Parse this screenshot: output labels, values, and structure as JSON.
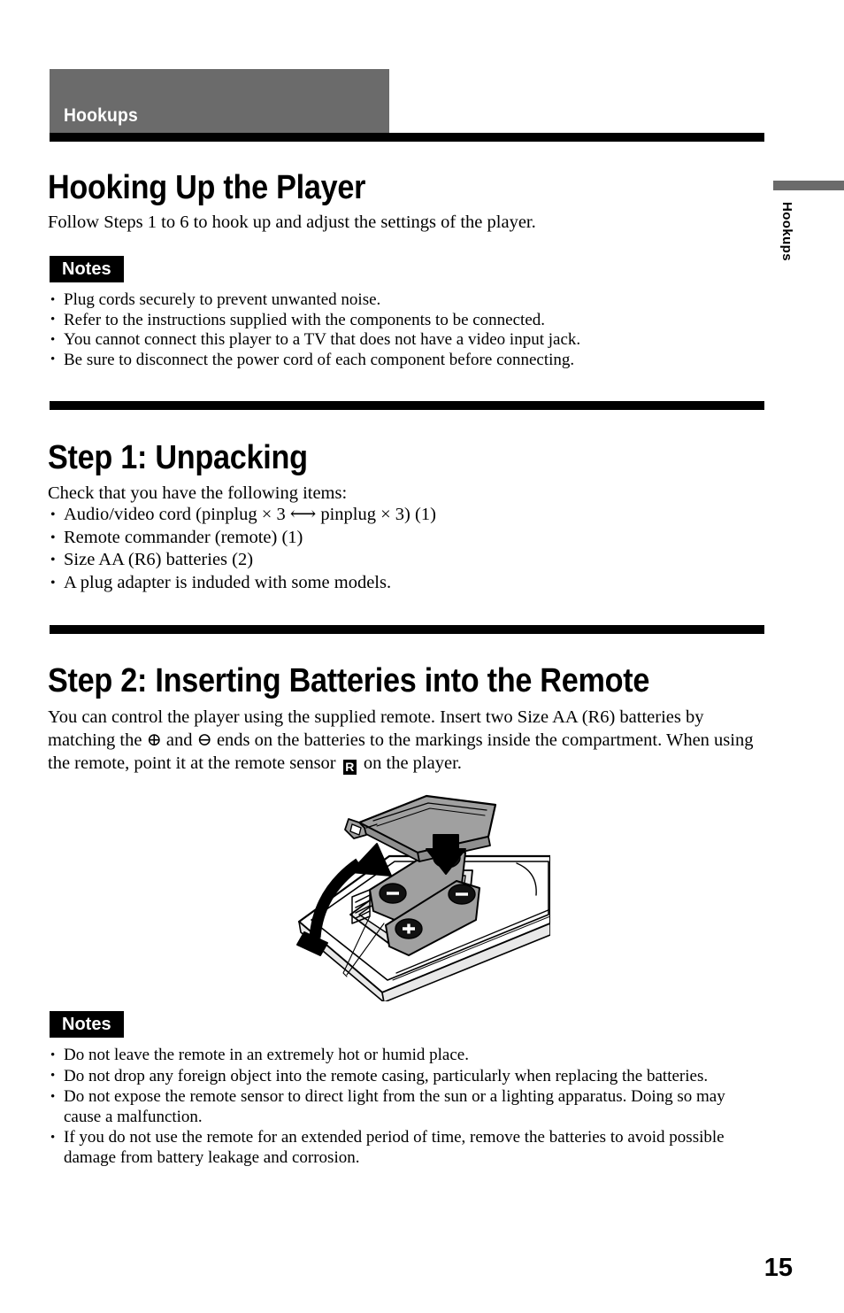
{
  "page": {
    "number": "15",
    "chapter": "Hookups",
    "side_tab": "Hookups"
  },
  "sections": [
    {
      "id": "hooking-up",
      "heading": "Hooking Up the Player",
      "intro": "Follow Steps 1 to 6 to hook up and adjust the settings of the player.",
      "notes_label": "Notes",
      "notes": [
        "Plug cords securely to prevent unwanted noise.",
        "Refer to the instructions supplied with the components to be connected.",
        "You cannot connect this player to a TV that does not have a video input jack.",
        "Be sure to disconnect the power cord of each component before connecting."
      ]
    },
    {
      "id": "step-1",
      "heading": "Step 1: Unpacking",
      "intro": "Check that you have the following items:",
      "items": [
        "Audio/video cord (pinplug × 3 ⟷ pinplug × 3) (1)",
        "Remote commander (remote) (1)",
        "Size AA (R6) batteries (2)",
        "A plug adapter is induded with some models."
      ]
    },
    {
      "id": "step-2",
      "heading": "Step 2: Inserting Batteries into the Remote",
      "body_part1": "You can control the player using the supplied remote. Insert two Size AA (R6) batteries by matching the ",
      "plus_symbol": "⊕",
      "body_part2": " and ",
      "minus_symbol": "⊖",
      "body_part3": " ends on the batteries to the markings inside the compartment. When using the remote, point it at the remote sensor ",
      "sensor_glyph": "R",
      "body_part4": " on the player.",
      "notes_label": "Notes",
      "notes": [
        "Do not leave the remote in an extremely hot or humid place.",
        "Do not drop any foreign object into the remote casing, particularly when replacing the batteries.",
        "Do not expose the remote sensor to direct light from the sun or a lighting apparatus. Doing so may cause a malfunction.",
        "If you do not use the remote for an extended period of time, remove the batteries to avoid possible damage from battery leakage and corrosion."
      ],
      "figure": {
        "caption": "Remote control with battery cover removed and two AA batteries being inserted",
        "battery_markings": [
          "+",
          "−",
          "+",
          "−"
        ]
      }
    }
  ],
  "colors": {
    "chapter_band": "#6b6b6b",
    "rule": "#000000",
    "page_background": "#ffffff",
    "figure_shade": "#a0a0a0",
    "figure_light": "#e8e8e8"
  }
}
